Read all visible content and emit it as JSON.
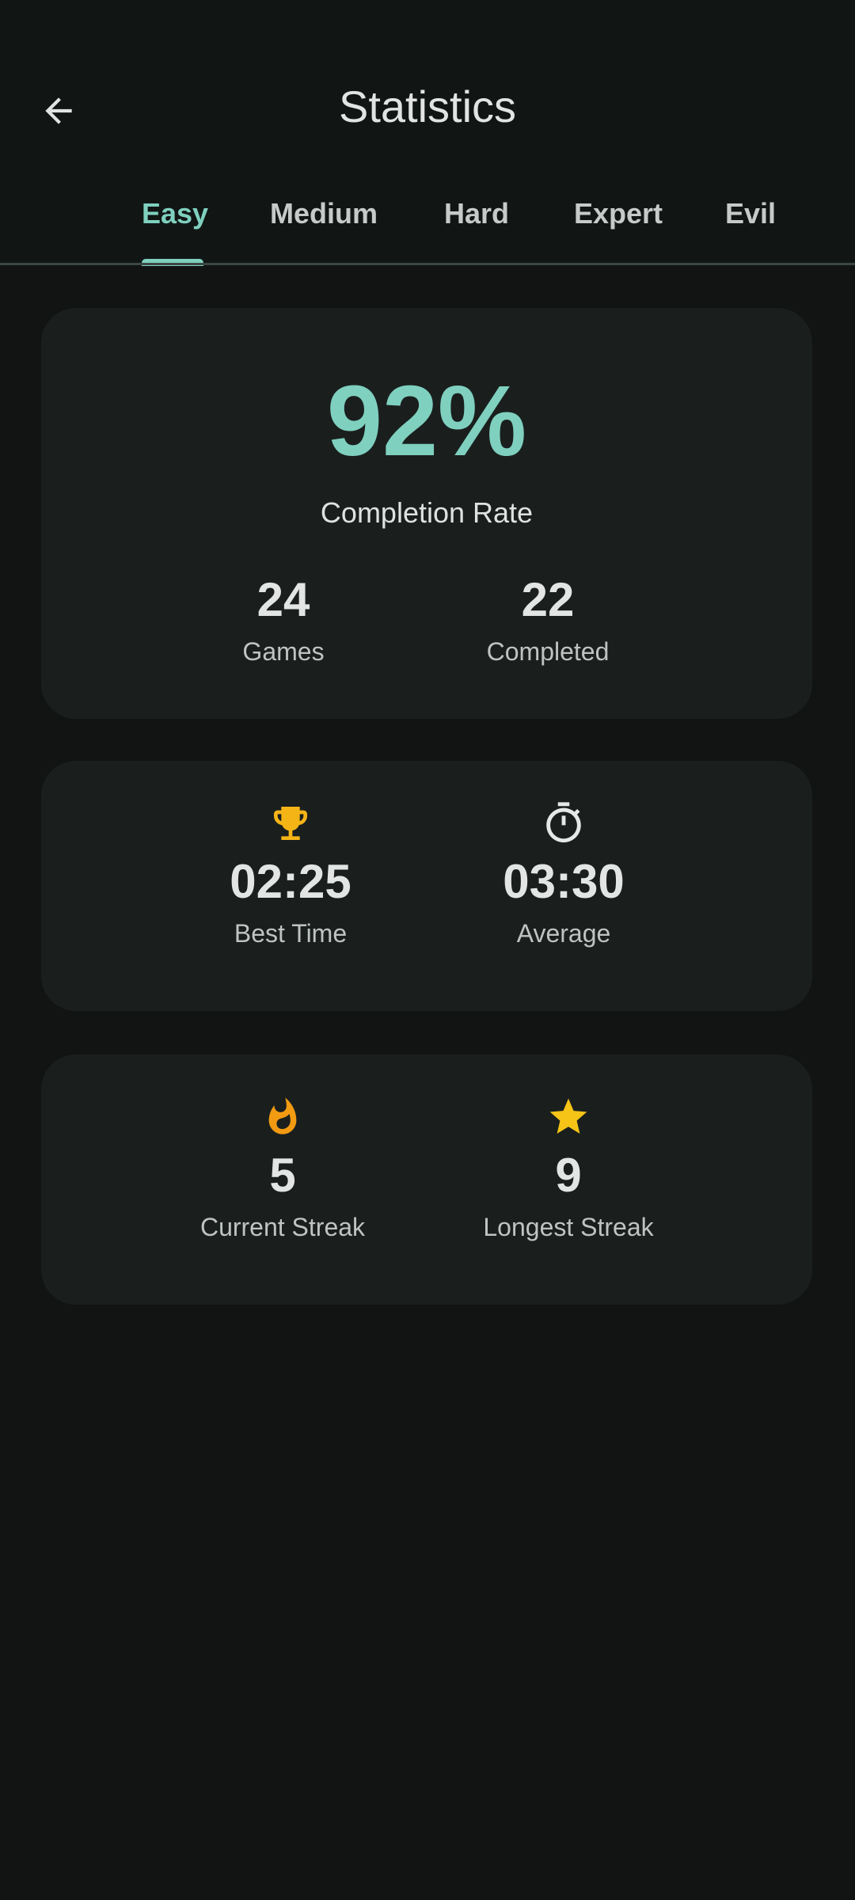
{
  "header": {
    "title": "Statistics",
    "back_icon": "arrow-back-icon"
  },
  "tabs": [
    {
      "label": "Easy",
      "active": true
    },
    {
      "label": "Medium",
      "active": false
    },
    {
      "label": "Hard",
      "active": false
    },
    {
      "label": "Expert",
      "active": false
    },
    {
      "label": "Evil",
      "active": false
    }
  ],
  "colors": {
    "accent": "#7fd0bf",
    "trophy": "#f5b416",
    "flame": "#f29a12",
    "star": "#f5c416",
    "background": "#121313",
    "card": "#1a1f1e"
  },
  "completion": {
    "rate": "92%",
    "label": "Completion Rate",
    "games_value": "24",
    "games_label": "Games",
    "completed_value": "22",
    "completed_label": "Completed"
  },
  "times": {
    "best_icon": "trophy-icon",
    "best_value": "02:25",
    "best_label": "Best Time",
    "average_icon": "stopwatch-icon",
    "average_value": "03:30",
    "average_label": "Average"
  },
  "streaks": {
    "current_icon": "flame-icon",
    "current_value": "5",
    "current_label": "Current Streak",
    "longest_icon": "star-icon",
    "longest_value": "9",
    "longest_label": "Longest Streak"
  }
}
